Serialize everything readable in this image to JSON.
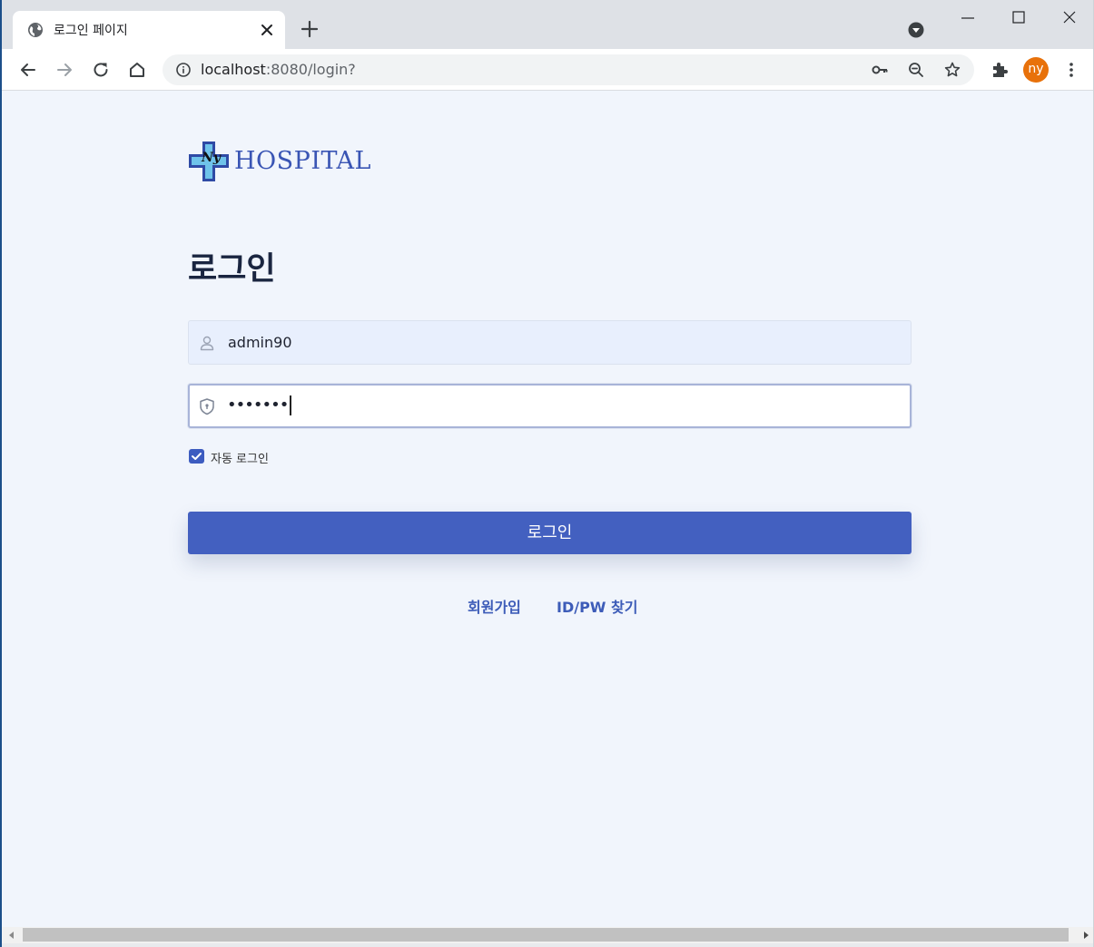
{
  "browser": {
    "tab_title": "로그인 페이지",
    "url_host": "localhost",
    "url_path": ":8080/login?",
    "profile_initials": "ny",
    "profile_color": "#e8710a"
  },
  "page": {
    "logo_text": "HOSPITAL",
    "logo_badge_text": "Ny",
    "heading": "로그인",
    "username_value": "admin90",
    "password_value": "•••••••",
    "remember_label": "자동 로그인",
    "remember_checked": true,
    "login_button_label": "로그인",
    "links": {
      "join": "회원가입",
      "find": "ID/PW 찾기"
    },
    "accent_color": "#4360c0"
  }
}
